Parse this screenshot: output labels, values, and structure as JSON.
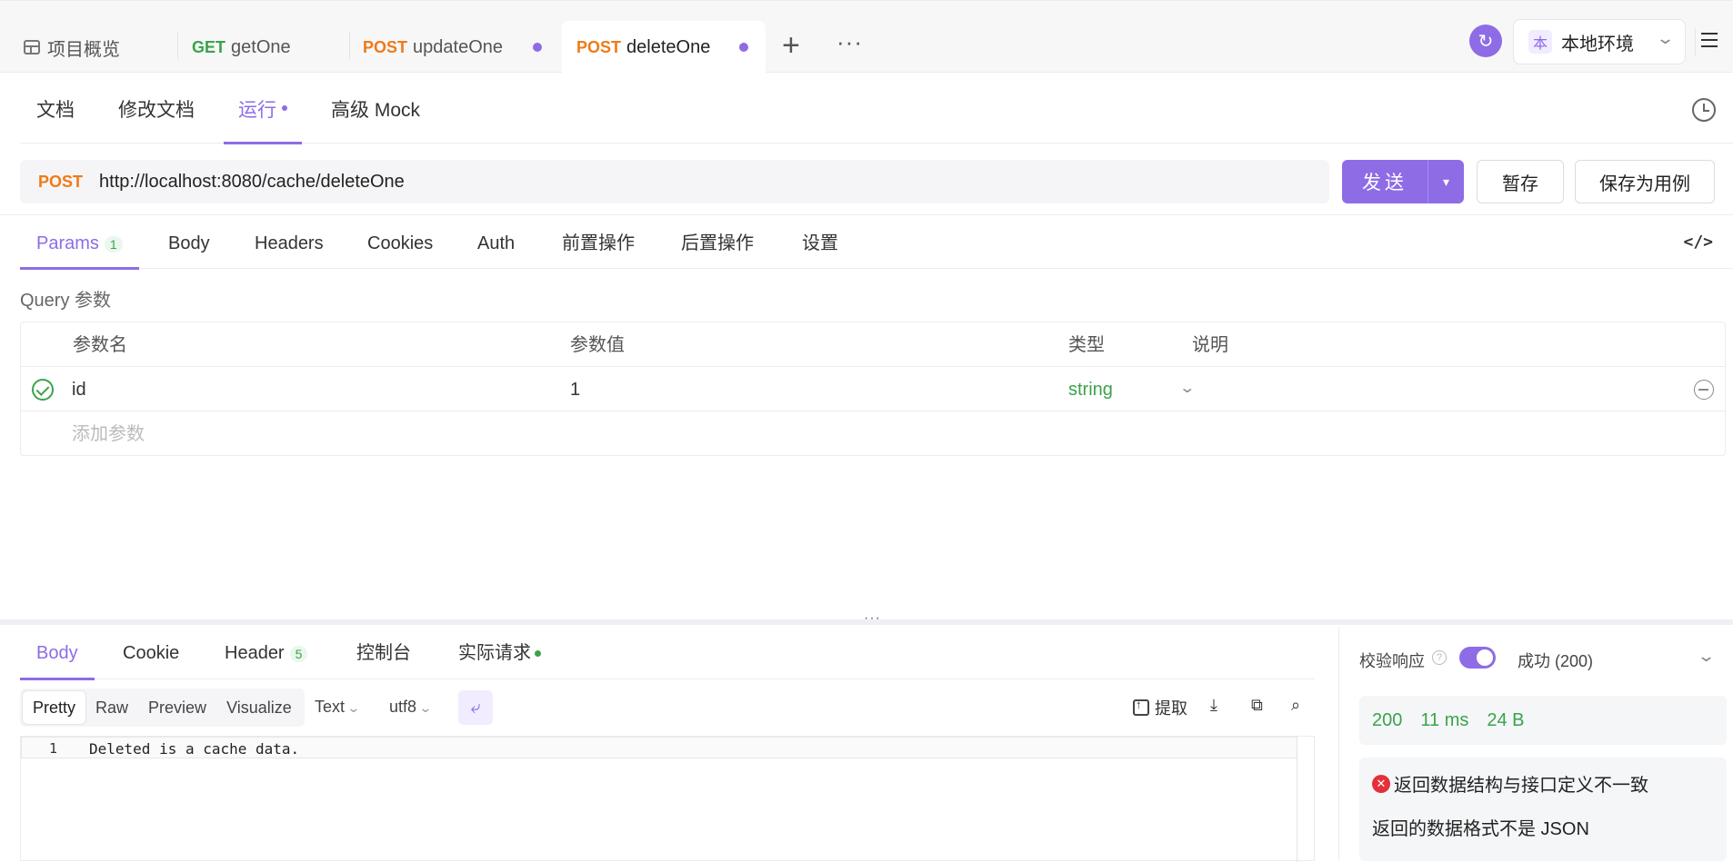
{
  "top_tabs": [
    {
      "label": "项目概览",
      "method": ""
    },
    {
      "label": "getOne",
      "method": "GET"
    },
    {
      "label": "updateOne",
      "method": "POST"
    },
    {
      "label": "deleteOne",
      "method": "POST"
    }
  ],
  "environment": {
    "badge": "本",
    "name": "本地环境"
  },
  "sub_tabs": [
    "文档",
    "修改文档",
    "运行",
    "高级 Mock"
  ],
  "request": {
    "method": "POST",
    "url": "http://localhost:8080/cache/deleteOne",
    "send_label": "发送",
    "save_label": "暂存",
    "save_case_label": "保存为用例"
  },
  "request_tabs": {
    "params": "Params",
    "params_count": "1",
    "body": "Body",
    "headers": "Headers",
    "cookies": "Cookies",
    "auth": "Auth",
    "pre": "前置操作",
    "post": "后置操作",
    "settings": "设置"
  },
  "query": {
    "title": "Query 参数",
    "headers": {
      "name": "参数名",
      "value": "参数值",
      "type": "类型",
      "desc": "说明"
    },
    "rows": [
      {
        "name": "id",
        "value": "1",
        "type": "string",
        "desc": ""
      }
    ],
    "add_placeholder": "添加参数"
  },
  "response_tabs": {
    "body": "Body",
    "cookie": "Cookie",
    "header": "Header",
    "header_count": "5",
    "console": "控制台",
    "actual": "实际请求"
  },
  "formats": [
    "Pretty",
    "Raw",
    "Preview",
    "Visualize"
  ],
  "format_active": "Pretty",
  "content_type": "Text",
  "encoding": "utf8",
  "extract_label": "提取",
  "body_lines": [
    {
      "no": "1",
      "text": "Deleted is a cache data."
    }
  ],
  "validation": {
    "label": "校验响应",
    "status": "成功 (200)",
    "enabled": true,
    "code": "200",
    "time": "11 ms",
    "size": "24 B",
    "error_title": "返回数据结构与接口定义不一致",
    "error_desc": "返回的数据格式不是 JSON"
  },
  "colors": {
    "accent": "#8e6ce6",
    "get": "#3aa34a",
    "post": "#ef7a18",
    "success": "#3aa34a",
    "error": "#e5303a"
  }
}
